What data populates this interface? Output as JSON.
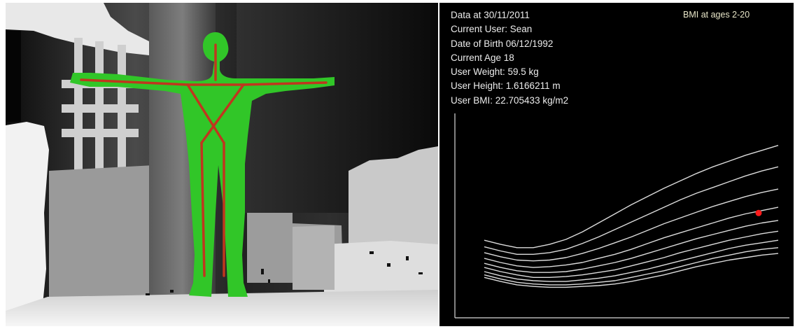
{
  "info": {
    "lines": [
      "Data at 30/11/2011",
      "Current User: Sean",
      "Date of Birth 06/12/1992",
      "Current Age 18",
      "User Weight: 59.5 kg",
      "User Height: 1.6166211 m",
      "User BMI: 22.705433 kg/m2"
    ]
  },
  "colors": {
    "body_fill": "#31c628",
    "skeleton": "#c0361e",
    "curve": "#dcdcdc",
    "user_point": "#ff1a1a",
    "axis": "#d8d8d8"
  },
  "chart_data": {
    "type": "line",
    "title": "BMI at ages 2-20",
    "xlabel": "",
    "ylabel": "",
    "grid": false,
    "legend": "none",
    "xlim": [
      2,
      20
    ],
    "ylim": [
      10,
      38
    ],
    "x": [
      2,
      3,
      4,
      5,
      6,
      7,
      8,
      9,
      10,
      11,
      12,
      13,
      14,
      15,
      16,
      17,
      18,
      19,
      20
    ],
    "series": [
      {
        "values": [
          14.9,
          14.4,
          14.0,
          13.8,
          13.7,
          13.7,
          13.8,
          13.9,
          14.1,
          14.4,
          14.8,
          15.2,
          15.7,
          16.2,
          16.6,
          17.0,
          17.3,
          17.6,
          17.8
        ]
      },
      {
        "values": [
          15.2,
          14.7,
          14.3,
          14.1,
          14.0,
          14.0,
          14.1,
          14.3,
          14.5,
          14.9,
          15.3,
          15.7,
          16.2,
          16.7,
          17.2,
          17.6,
          18.0,
          18.3,
          18.5
        ]
      },
      {
        "values": [
          15.6,
          15.1,
          14.7,
          14.5,
          14.4,
          14.4,
          14.6,
          14.8,
          15.1,
          15.5,
          15.9,
          16.4,
          16.9,
          17.4,
          17.9,
          18.4,
          18.8,
          19.1,
          19.4
        ]
      },
      {
        "values": [
          16.1,
          15.6,
          15.2,
          14.9,
          14.9,
          15.0,
          15.2,
          15.5,
          15.8,
          16.3,
          16.8,
          17.3,
          17.9,
          18.4,
          18.9,
          19.4,
          19.8,
          20.2,
          20.5
        ]
      },
      {
        "values": [
          16.6,
          16.1,
          15.7,
          15.5,
          15.5,
          15.6,
          15.9,
          16.3,
          16.7,
          17.2,
          17.8,
          18.4,
          19.0,
          19.6,
          20.1,
          20.6,
          21.1,
          21.5,
          21.8
        ]
      },
      {
        "values": [
          17.2,
          16.7,
          16.3,
          16.1,
          16.2,
          16.4,
          16.7,
          17.2,
          17.7,
          18.3,
          19.0,
          19.7,
          20.3,
          20.9,
          21.5,
          22.1,
          22.6,
          23.0,
          23.4
        ]
      },
      {
        "values": [
          17.9,
          17.4,
          17.0,
          16.9,
          17.0,
          17.3,
          17.8,
          18.4,
          19.1,
          19.8,
          20.6,
          21.4,
          22.1,
          22.8,
          23.5,
          24.1,
          24.7,
          25.2,
          25.6
        ]
      },
      {
        "values": [
          18.6,
          18.1,
          17.7,
          17.7,
          17.9,
          18.3,
          19.0,
          19.8,
          20.7,
          21.6,
          22.5,
          23.4,
          24.3,
          25.1,
          25.8,
          26.5,
          27.2,
          27.8,
          28.3
        ]
      },
      {
        "values": [
          19.4,
          18.9,
          18.5,
          18.5,
          18.9,
          19.5,
          20.4,
          21.5,
          22.6,
          23.7,
          24.7,
          25.7,
          26.6,
          27.5,
          28.3,
          29.0,
          29.7,
          30.3,
          30.9
        ]
      }
    ],
    "points": [
      {
        "x": 18.8,
        "y": 22.7
      }
    ]
  }
}
